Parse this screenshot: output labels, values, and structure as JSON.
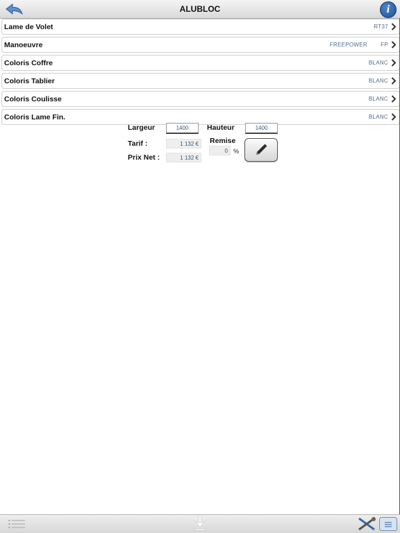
{
  "header": {
    "title": "ALUBLOC",
    "back_icon": "back-arrow-icon",
    "info_label": "i"
  },
  "options": [
    {
      "label": "Lame de Volet",
      "value": "RT37"
    },
    {
      "label": "Manoeuvre",
      "value_mid": "FREEPOWER",
      "value": "FP"
    },
    {
      "label": "Coloris Coffre",
      "value": "BLANC"
    },
    {
      "label": "Coloris Tablier",
      "value": "BLANC"
    },
    {
      "label": "Coloris Coulisse",
      "value": "BLANC"
    },
    {
      "label": "Coloris Lame Fin.",
      "value": "BLANC"
    }
  ],
  "form": {
    "largeur_label": "Largeur",
    "largeur_value": "1400",
    "hauteur_label": "Hauteur",
    "hauteur_value": "1400",
    "tarif_label": "Tarif :",
    "tarif_value": "1 132 €",
    "remise_label": "Remise",
    "remise_value": "0",
    "remise_unit": "%",
    "prix_net_label": "Prix Net :",
    "prix_net_value": "1 132 €",
    "edit_icon": "pencil-icon"
  },
  "footer": {
    "icons": [
      "list-icon",
      "download-icon",
      "tools-icon",
      "keyboard-icon"
    ]
  },
  "colors": {
    "accent_blue": "#1e4f93",
    "value_text": "#556a89",
    "edge_line": "#7d3b84"
  }
}
